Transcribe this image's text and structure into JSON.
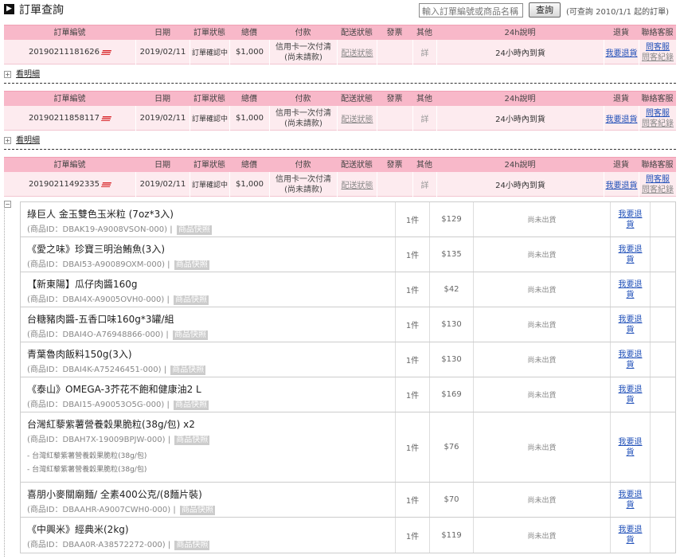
{
  "header": {
    "title": "訂單查詢",
    "search_placeholder": "輸入訂單編號或商品名稱",
    "query_button": "查詢",
    "hint": "(可查詢 2010/1/1 起的訂單)"
  },
  "columns": {
    "order_no": "訂單編號",
    "date": "日期",
    "status": "訂單狀態",
    "total": "總價",
    "payment": "付款",
    "shipping": "配送狀態",
    "invoice": "發票",
    "other": "其他",
    "h24": "24h說明",
    "return": "退貨",
    "contact": "聯絡客服"
  },
  "orders": [
    {
      "order_no": "20190211181626",
      "date": "2019/02/11",
      "status": "訂單確認中",
      "total": "$1,000",
      "payment_line1": "信用卡一次付清",
      "payment_line2": "(尚未請款)",
      "shipping": "配送狀態",
      "other": "詳",
      "h24": "24小時內到貨",
      "return": "我要退貨",
      "contact_ask": "問客服",
      "contact_record": "問客紀錄",
      "detail_toggle": "+",
      "detail_label": "看明細"
    },
    {
      "order_no": "20190211858117",
      "date": "2019/02/11",
      "status": "訂單確認中",
      "total": "$1,000",
      "payment_line1": "信用卡一次付清",
      "payment_line2": "(尚未請款)",
      "shipping": "配送狀態",
      "other": "詳",
      "h24": "24小時內到貨",
      "return": "我要退貨",
      "contact_ask": "問客服",
      "contact_record": "問客紀錄",
      "detail_toggle": "+",
      "detail_label": "看明細"
    },
    {
      "order_no": "20190211492335",
      "date": "2019/02/11",
      "status": "訂單確認中",
      "total": "$1,000",
      "payment_line1": "信用卡一次付清",
      "payment_line2": "(尚未請款)",
      "shipping": "配送狀態",
      "other": "詳",
      "h24": "24小時內到貨",
      "return": "我要退貨",
      "contact_ask": "問客服",
      "contact_record": "問客紀錄",
      "detail_toggle": "−"
    }
  ],
  "items": [
    {
      "name": "綠巨人 金玉雙色玉米粒 (7oz*3入)",
      "id": "(商品ID：DBAK19-A9008VSON-000)",
      "qty": "1件",
      "price": "$129",
      "status": "尚未出貨",
      "return_a": "我要退",
      "return_b": "貨"
    },
    {
      "name": "《愛之味》珍寶三明治鮪魚(3入)",
      "id": "(商品ID：DBAI53-A90089OXM-000)",
      "qty": "1件",
      "price": "$135",
      "status": "尚未出貨",
      "return_a": "我要退",
      "return_b": "貨"
    },
    {
      "name": "【新東陽】瓜仔肉醬160g",
      "id": "(商品ID：DBAI4X-A9005OVH0-000)",
      "qty": "1件",
      "price": "$42",
      "status": "尚未出貨",
      "return_a": "我要退",
      "return_b": "貨"
    },
    {
      "name": "台糖豬肉醬-五香口味160g*3罐/組",
      "id": "(商品ID：DBAI4O-A76948866-000)",
      "qty": "1件",
      "price": "$130",
      "status": "尚未出貨",
      "return_a": "我要退",
      "return_b": "貨"
    },
    {
      "name": "青葉魯肉飯料150g(3入)",
      "id": "(商品ID：DBAI4K-A75246451-000)",
      "qty": "1件",
      "price": "$130",
      "status": "尚未出貨",
      "return_a": "我要退",
      "return_b": "貨"
    },
    {
      "name": "《泰山》OMEGA-3芥花不飽和健康油2 L",
      "id": "(商品ID：DBAI15-A90053O5G-000)",
      "qty": "1件",
      "price": "$169",
      "status": "尚未出貨",
      "return_a": "我要退",
      "return_b": "貨"
    },
    {
      "name": "台灣紅藜紫薯營養穀果脆粒(38g/包) x2",
      "id": "(商品ID：DBAH7X-19009BPJW-000)",
      "qty": "1件",
      "price": "$76",
      "status": "尚未出貨",
      "return_a": "我要退",
      "return_b": "貨",
      "sub1": "- 台灣紅藜紫薯營養穀果脆粒(38g/包)",
      "sub2": "- 台灣紅藜紫薯營養穀果脆粒(38g/包)"
    },
    {
      "name": "喜朋小麥關廟麵/ 全素400公克/(8麵片裝)",
      "id": "(商品ID：DBAAHR-A9007CWH0-000)",
      "qty": "1件",
      "price": "$70",
      "status": "尚未出貨",
      "return_a": "我要退",
      "return_b": "貨"
    },
    {
      "name": "《中興米》經典米(2kg)",
      "id": "(商品ID：DBAA0R-A38572272-000)",
      "qty": "1件",
      "price": "$119",
      "status": "尚未出貨",
      "return_a": "我要退",
      "return_b": "貨"
    }
  ],
  "tag": "商品快照",
  "id_separator": "|",
  "colors": {
    "header_pink": "#f8b8c9",
    "row_pink": "#fdebef",
    "link": "#1f4fb8",
    "flag_red": "#d9262b"
  }
}
